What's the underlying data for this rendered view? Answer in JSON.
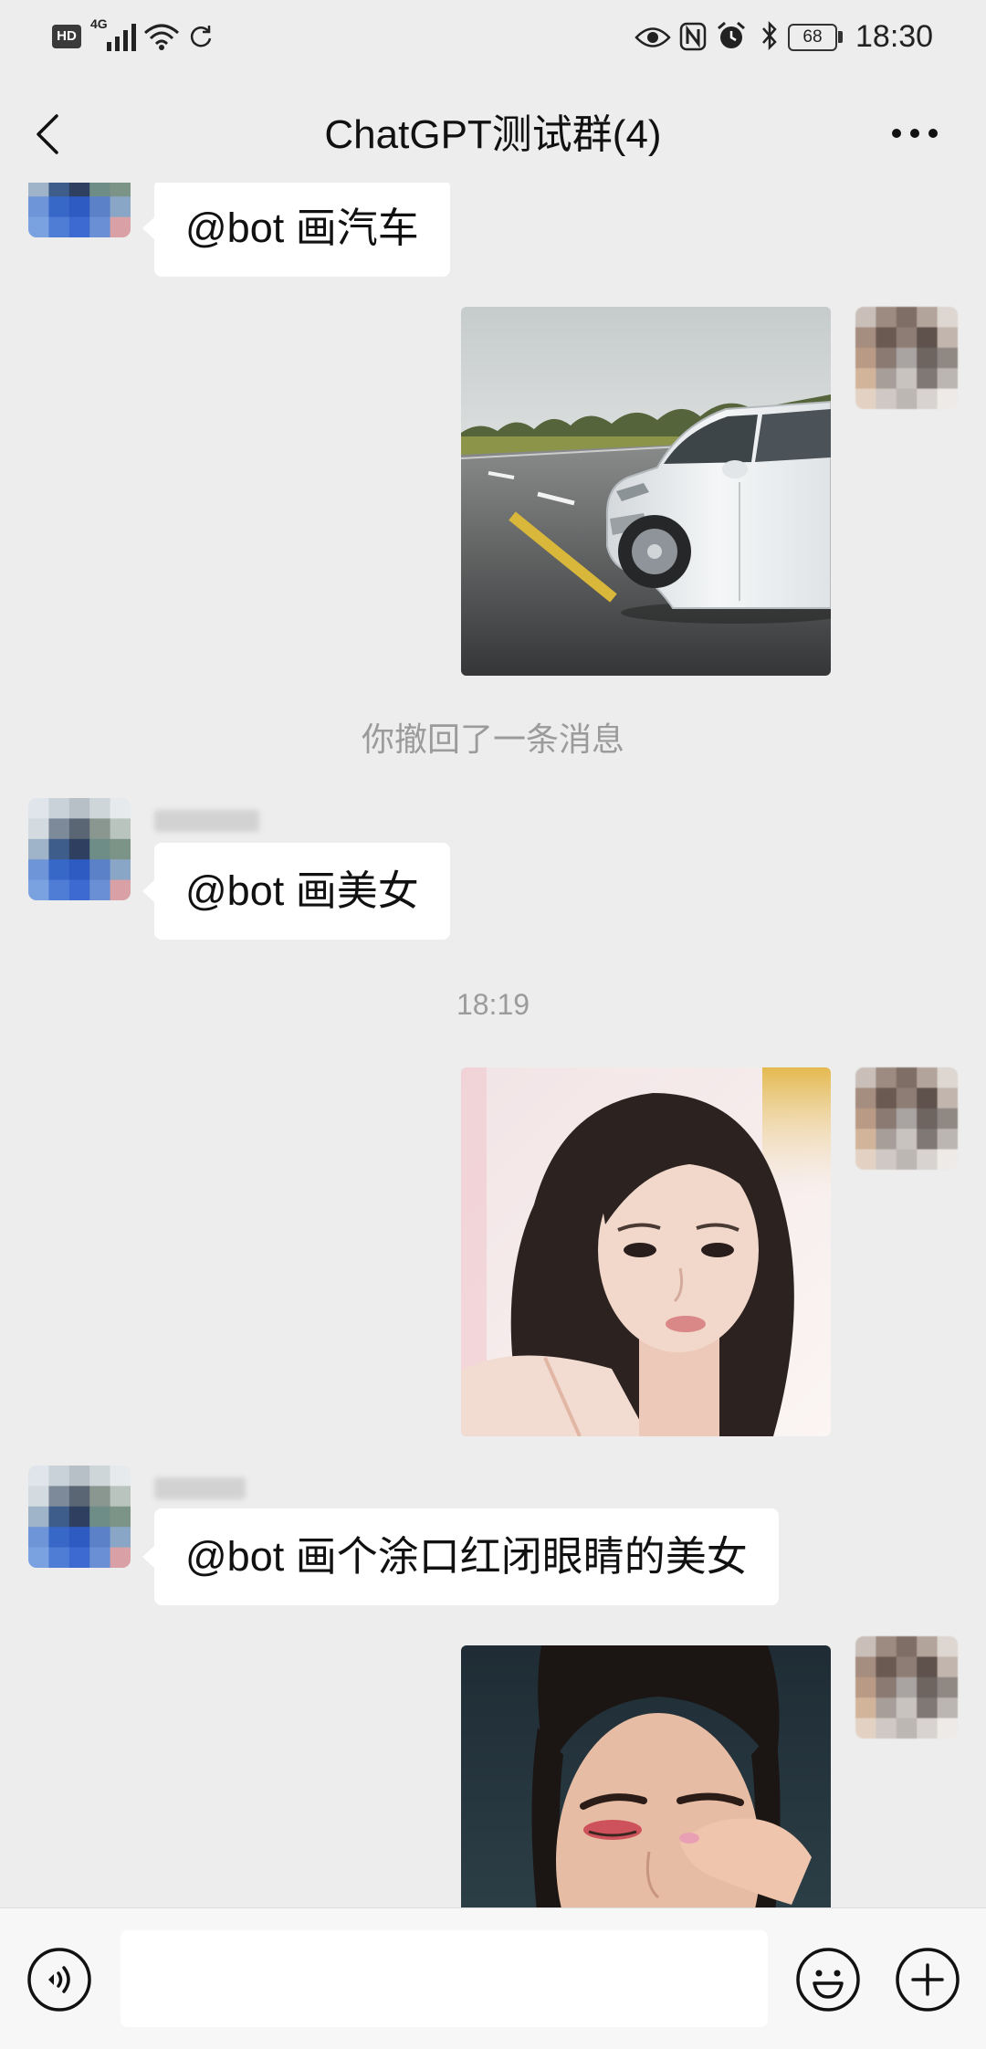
{
  "status_bar": {
    "hd_label": "HD",
    "network_label": "4G",
    "battery_level": "68",
    "time": "18:30",
    "icons": [
      "hd-icon",
      "signal-icon",
      "wifi-icon",
      "sync-icon",
      "eye-icon",
      "nfc-icon",
      "alarm-icon",
      "bluetooth-icon",
      "battery-icon"
    ]
  },
  "header": {
    "title": "ChatGPT测试群(4)",
    "icons": [
      "chevron-left-icon",
      "more-icon"
    ]
  },
  "chat": {
    "messages": [
      "@bot 画汽车",
      "@bot 画美女",
      "@bot 画个涂口红闭眼睛的美女"
    ],
    "recall_notice": "你撤回了一条消息",
    "timestamp": "18:19"
  },
  "input_bar": {
    "value": "",
    "icons": [
      "voice-icon",
      "emoji-icon",
      "plus-icon"
    ]
  },
  "colors": {
    "chat_background": "#ededed",
    "bubble_background": "#ffffff",
    "meta_text": "#9b9b9b",
    "input_bar_background": "#f7f7f7"
  }
}
